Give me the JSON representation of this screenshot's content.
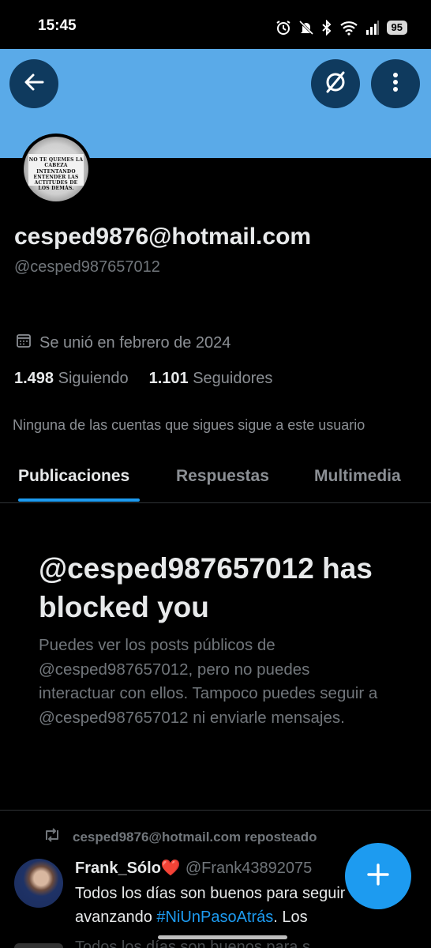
{
  "status_bar": {
    "time": "15:45",
    "battery": "95"
  },
  "banner": {
    "color": "#5aaae8"
  },
  "avatar_image_text": "NO TE QUEMES LA CABEZA INTENTANDO ENTENDER LAS ACTITUDES DE LOS DEMÁS.",
  "profile": {
    "display_name": "cesped9876@hotmail.com",
    "handle": "@cesped987657012",
    "joined": "Se unió en febrero de 2024",
    "following_count": "1.498",
    "following_label": "Siguiendo",
    "followers_count": "1.101",
    "followers_label": "Seguidores",
    "mutuals_note": "Ninguna de las cuentas que sigues sigue a este usuario"
  },
  "tabs": [
    {
      "label": "Publicaciones",
      "active": true
    },
    {
      "label": "Respuestas",
      "active": false
    },
    {
      "label": "Multimedia",
      "active": false
    }
  ],
  "blocked": {
    "title": "@cesped987657012 has blocked you",
    "body": "Puedes ver los posts públicos de @cesped987657012, pero no puedes interactuar con ellos. Tampoco puedes seguir a @cesped987657012 ni enviarle mensajes."
  },
  "post": {
    "repost_label": "cesped9876@hotmail.com reposteado",
    "author": "Frank_Sólo",
    "author_emoji": "❤️",
    "handle": "@Frank43892075",
    "text_start": "Todos los días son buenos para seguir avanzando ",
    "hashtag": "#NiUnPasoAtrás",
    "text_end": ". Los"
  },
  "peek_text": "Todos los días son buenos para s",
  "colors": {
    "accent": "#1d9bf0",
    "banner": "#5aaae8",
    "button_bg": "#0f3a5e",
    "muted_text": "#71767b"
  },
  "icons": [
    "back-arrow-icon",
    "grok-icon",
    "more-vertical-icon",
    "calendar-icon",
    "repost-icon",
    "plus-icon",
    "alarm-icon",
    "mute-icon",
    "bluetooth-icon",
    "wifi-icon",
    "signal-icon"
  ]
}
